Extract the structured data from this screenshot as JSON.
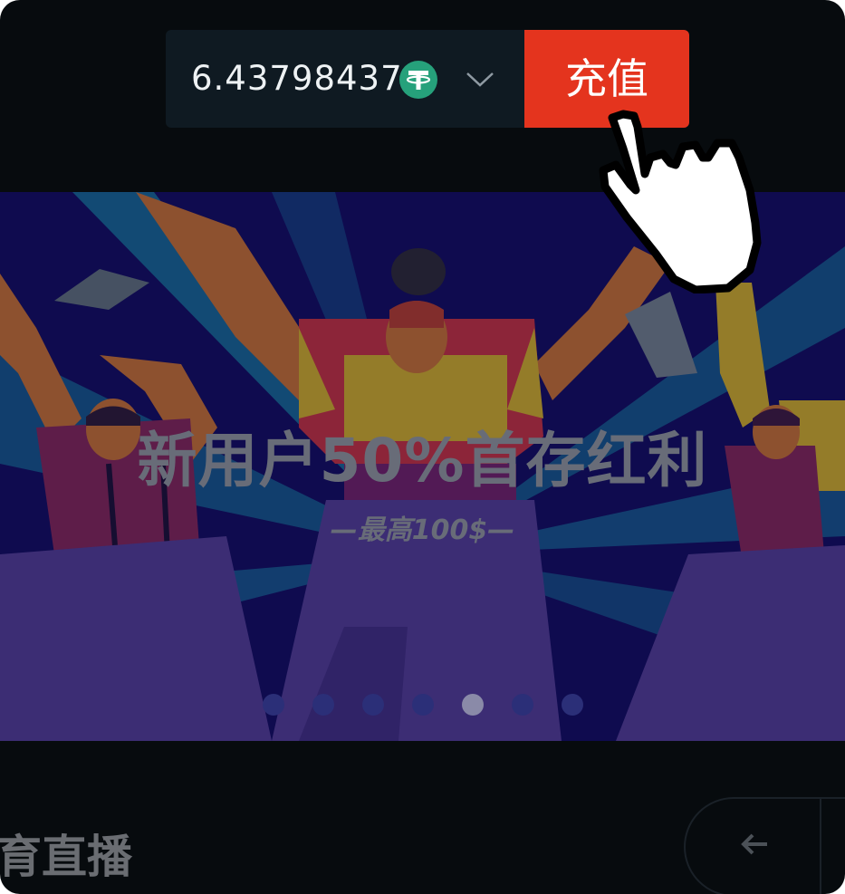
{
  "wallet": {
    "balance": "6.43798437",
    "currency_icon": "usdt-tether-icon",
    "dropdown_icon": "chevron-down-icon",
    "deposit_label": "充值",
    "deposit_color": "#e4341e"
  },
  "banner": {
    "title": "新用户50%首存红利",
    "subtitle": "—最高100$—",
    "slides_total": 7,
    "active_slide": 5
  },
  "section": {
    "title": "育直播",
    "back_icon": "arrow-left-icon"
  },
  "cursor": {
    "icon": "pointer-hand-icon"
  }
}
